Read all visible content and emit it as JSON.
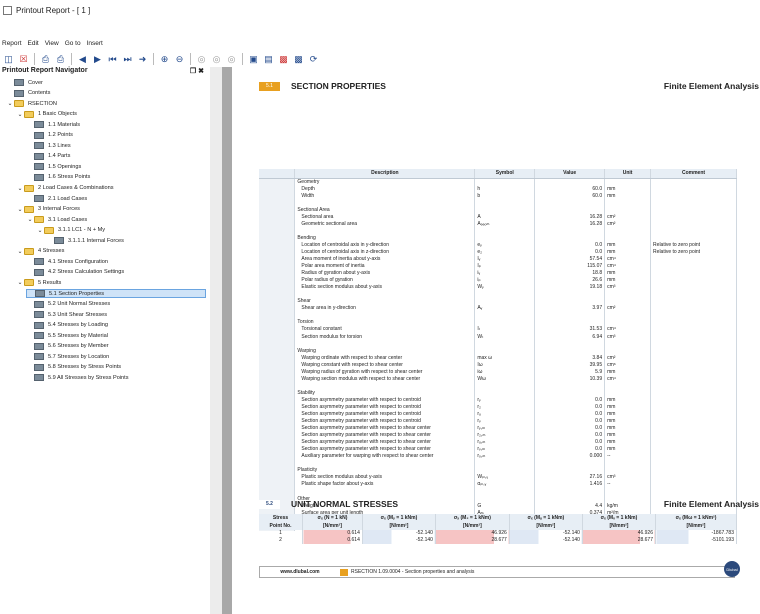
{
  "window": {
    "title": "Printout Report - [ 1 ]"
  },
  "menu": [
    "Report",
    "Edit",
    "View",
    "Go to",
    "Insert"
  ],
  "navigator": {
    "title": "Printout Report Navigator",
    "pin": "❒",
    "close": "✖",
    "items": [
      {
        "label": "Cover",
        "level": 0,
        "type": "doc"
      },
      {
        "label": "Contents",
        "level": 0,
        "type": "doc"
      },
      {
        "label": "RSECTION",
        "level": 0,
        "type": "folder",
        "chev": "⌄"
      },
      {
        "label": "1 Basic Objects",
        "level": 1,
        "type": "folder",
        "chev": "⌄"
      },
      {
        "label": "1.1 Materials",
        "level": 2,
        "type": "doc"
      },
      {
        "label": "1.2 Points",
        "level": 2,
        "type": "doc"
      },
      {
        "label": "1.3 Lines",
        "level": 2,
        "type": "doc"
      },
      {
        "label": "1.4 Parts",
        "level": 2,
        "type": "doc"
      },
      {
        "label": "1.5 Openings",
        "level": 2,
        "type": "doc"
      },
      {
        "label": "1.6 Stress Points",
        "level": 2,
        "type": "doc"
      },
      {
        "label": "2 Load Cases & Combinations",
        "level": 1,
        "type": "folder",
        "chev": "⌄"
      },
      {
        "label": "2.1 Load Cases",
        "level": 2,
        "type": "doc"
      },
      {
        "label": "3 Internal Forces",
        "level": 1,
        "type": "folder",
        "chev": "⌄"
      },
      {
        "label": "3.1 Load Cases",
        "level": 2,
        "type": "folder",
        "chev": "⌄"
      },
      {
        "label": "3.1.1 LC1 - N + My",
        "level": 3,
        "type": "folder",
        "chev": "⌄"
      },
      {
        "label": "3.1.1.1 Internal Forces",
        "level": 4,
        "type": "doc"
      },
      {
        "label": "4 Stresses",
        "level": 1,
        "type": "folder",
        "chev": "⌄"
      },
      {
        "label": "4.1 Stress Configuration",
        "level": 2,
        "type": "doc"
      },
      {
        "label": "4.2 Stress Calculation Settings",
        "level": 2,
        "type": "doc"
      },
      {
        "label": "5 Results",
        "level": 1,
        "type": "folder",
        "chev": "⌄"
      },
      {
        "label": "5.1 Section Properties",
        "level": 2,
        "type": "doc",
        "selected": true
      },
      {
        "label": "5.2 Unit Normal Stresses",
        "level": 2,
        "type": "doc"
      },
      {
        "label": "5.3 Unit Shear Stresses",
        "level": 2,
        "type": "doc"
      },
      {
        "label": "5.4 Stresses by Loading",
        "level": 2,
        "type": "doc"
      },
      {
        "label": "5.5 Stresses by Material",
        "level": 2,
        "type": "doc"
      },
      {
        "label": "5.6 Stresses by Member",
        "level": 2,
        "type": "doc"
      },
      {
        "label": "5.7 Stresses by Location",
        "level": 2,
        "type": "doc"
      },
      {
        "label": "5.8 Stresses by Stress Points",
        "level": 2,
        "type": "doc"
      },
      {
        "label": "5.9 All Stresses by Stress Points",
        "level": 2,
        "type": "doc"
      }
    ]
  },
  "section1": {
    "num": "5.1",
    "title": "SECTION PROPERTIES",
    "brand": "Finite Element Analysis",
    "headers": [
      "",
      "Description",
      "Symbol",
      "Value",
      "Unit",
      "Comment"
    ],
    "rows": [
      [
        "",
        "Geometry",
        "",
        "",
        "",
        ""
      ],
      [
        "",
        "Depth",
        "h",
        "60.0",
        "mm",
        ""
      ],
      [
        "",
        "Width",
        "b",
        "60.0",
        "mm",
        ""
      ],
      [
        "",
        "",
        "",
        "",
        "",
        ""
      ],
      [
        "",
        "Sectional Area",
        "",
        "",
        "",
        ""
      ],
      [
        "",
        "Sectional area",
        "A",
        "16.28",
        "cm²",
        ""
      ],
      [
        "",
        "Geometric sectional area",
        "A₉ₑₒₘ",
        "16.28",
        "cm²",
        ""
      ],
      [
        "",
        "",
        "",
        "",
        "",
        ""
      ],
      [
        "",
        "Bending",
        "",
        "",
        "",
        ""
      ],
      [
        "",
        "Location of centroidal axis in y-direction",
        "eᵧ",
        "0.0",
        "mm",
        "Relative to zero point"
      ],
      [
        "",
        "Location of centroidal axis in z-direction",
        "e₂",
        "0.0",
        "mm",
        "Relative to zero point"
      ],
      [
        "",
        "Area moment of inertia about y-axis",
        "Iᵧ",
        "57.54",
        "cm⁴",
        ""
      ],
      [
        "",
        "Polar area moment of inertia",
        "Iₚ",
        "115.07",
        "cm⁴",
        ""
      ],
      [
        "",
        "Radius of gyration about y-axis",
        "iᵧ",
        "18.8",
        "mm",
        ""
      ],
      [
        "",
        "Polar radius of gyration",
        "iₚ",
        "26.6",
        "mm",
        ""
      ],
      [
        "",
        "Elastic section modulus about y-axis",
        "Wᵧ",
        "19.18",
        "cm³",
        ""
      ],
      [
        "",
        "",
        "",
        "",
        "",
        ""
      ],
      [
        "",
        "Shear",
        "",
        "",
        "",
        ""
      ],
      [
        "",
        "Shear area in y-direction",
        "Aᵧ",
        "3.97",
        "cm²",
        ""
      ],
      [
        "",
        "",
        "",
        "",
        "",
        ""
      ],
      [
        "",
        "Torsion",
        "",
        "",
        "",
        ""
      ],
      [
        "",
        "Torsional constant",
        "Iₜ",
        "31.53",
        "cm⁴",
        ""
      ],
      [
        "",
        "Section modulus for torsion",
        "Wₜ",
        "6.94",
        "cm³",
        ""
      ],
      [
        "",
        "",
        "",
        "",
        "",
        ""
      ],
      [
        "",
        "Warping",
        "",
        "",
        "",
        ""
      ],
      [
        "",
        "Warping ordinate with respect to shear center",
        "max ω",
        "3.84",
        "cm²",
        ""
      ],
      [
        "",
        "Warping constant with respect to shear center",
        "Iω",
        "39.95",
        "cm⁶",
        ""
      ],
      [
        "",
        "Warping radius of gyration with respect to shear center",
        "iω",
        "5.9",
        "mm",
        ""
      ],
      [
        "",
        "Warping section modulus with respect to shear center",
        "Wω",
        "10.39",
        "cm⁴",
        ""
      ],
      [
        "",
        "",
        "",
        "",
        "",
        ""
      ],
      [
        "",
        "Stability",
        "",
        "",
        "",
        ""
      ],
      [
        "",
        "Section asymmetry parameter with respect to centroid",
        "rᵧ",
        "0.0",
        "mm",
        ""
      ],
      [
        "",
        "Section asymmetry parameter with respect to centroid",
        "r₂",
        "0.0",
        "mm",
        ""
      ],
      [
        "",
        "Section asymmetry parameter with respect to centroid",
        "rᵤ",
        "0.0",
        "mm",
        ""
      ],
      [
        "",
        "Section asymmetry parameter with respect to centroid",
        "rᵥ",
        "0.0",
        "mm",
        ""
      ],
      [
        "",
        "Section asymmetry parameter with respect to shear center",
        "rᵧ,ₘ",
        "0.0",
        "mm",
        ""
      ],
      [
        "",
        "Section asymmetry parameter with respect to shear center",
        "r₂,ₘ",
        "0.0",
        "mm",
        ""
      ],
      [
        "",
        "Section asymmetry parameter with respect to shear center",
        "rᵤ,ₘ",
        "0.0",
        "mm",
        ""
      ],
      [
        "",
        "Section asymmetry parameter with respect to shear center",
        "rᵥ,ₘ",
        "0.0",
        "mm",
        ""
      ],
      [
        "",
        "Auxiliary parameter for warping with respect to shear center",
        "rₒ,ₘ",
        "0.000",
        "--",
        ""
      ],
      [
        "",
        "",
        "",
        "",
        "",
        ""
      ],
      [
        "",
        "Plasticity",
        "",
        "",
        "",
        ""
      ],
      [
        "",
        "Plastic section modulus about y-axis",
        "Wₚₗ,ᵧ",
        "27.16",
        "cm³",
        ""
      ],
      [
        "",
        "Plastic shape factor about y-axis",
        "αₚₗ,ᵧ",
        "1.416",
        "--",
        ""
      ],
      [
        "",
        "",
        "",
        "",
        "",
        ""
      ],
      [
        "",
        "Other",
        "",
        "",
        "",
        ""
      ],
      [
        "",
        "Weight",
        "G",
        "4.4",
        "kg/m",
        ""
      ],
      [
        "",
        "Surface area per unit length",
        "Aₘ",
        "0.374",
        "m²/m",
        ""
      ],
      [
        "",
        "Volume",
        "V",
        "1627.62",
        "cm³/m",
        ""
      ],
      [
        "",
        "Section factor",
        "Aₘ/V",
        "229.478",
        "1/m",
        ""
      ]
    ]
  },
  "section2": {
    "num": "5.2",
    "title": "UNIT NORMAL STRESSES",
    "brand": "Finite Element Analysis",
    "headers": [
      [
        "Stress",
        "Point No."
      ],
      [
        "σₓ (N = 1 kN)",
        "[N/mm²]"
      ],
      [
        "σₓ (Mᵧ = 1 kNm)",
        "[N/mm²]"
      ],
      [
        "σₓ (M₂ = 1 kNm)",
        "[N/mm²]"
      ],
      [
        "σₓ (Mᵤ = 1 kNm)",
        "[N/mm²]"
      ],
      [
        "σₓ (Mᵥ = 1 kNm)",
        "[N/mm²]"
      ],
      [
        "σₓ (Mω = 1 kNm²)",
        "[N/mm²]"
      ]
    ],
    "rows": [
      [
        "1",
        "0.614",
        "-52.140",
        "46.926",
        "-52.140",
        "46.926",
        "-1867.783"
      ],
      [
        "2",
        "0.614",
        "-52.140",
        "28.677",
        "-52.140",
        "28.677",
        "-5101.193"
      ]
    ]
  },
  "footer": {
    "url": "www.dlubal.com",
    "product": "RSECTION 1.09.0004 - Section properties and analysis",
    "logo": "Dlubal"
  }
}
